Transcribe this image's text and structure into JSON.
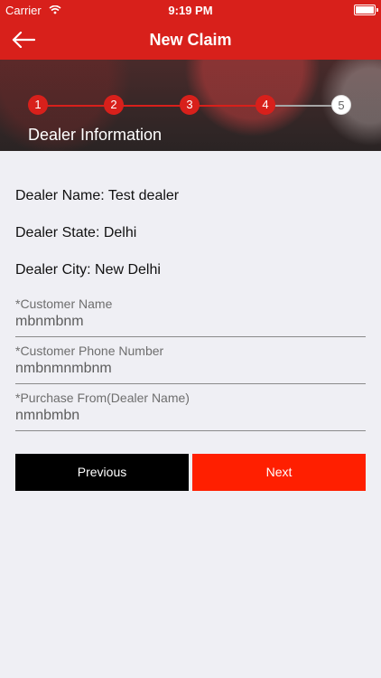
{
  "status_bar": {
    "carrier": "Carrier",
    "time": "9:19 PM"
  },
  "nav": {
    "title": "New Claim",
    "back_icon": "back-arrow-icon"
  },
  "steps": {
    "items": [
      "1",
      "2",
      "3",
      "4",
      "5"
    ],
    "active_count": 4,
    "section_title": "Dealer Information",
    "active_color": "#d8201b"
  },
  "info": {
    "dealer_name": "Dealer Name: Test dealer",
    "dealer_state": "Dealer State: Delhi",
    "dealer_city": "Dealer City: New Delhi"
  },
  "fields": [
    {
      "label": "*Customer Name",
      "value": "mbnmbnm"
    },
    {
      "label": "*Customer Phone Number",
      "value": "nmbnmnmbnm"
    },
    {
      "label": "*Purchase From(Dealer Name)",
      "value": "nmnbmbn"
    }
  ],
  "buttons": {
    "previous": "Previous",
    "next": "Next"
  },
  "colors": {
    "brand": "#d8201b",
    "next_button": "#ff1f00",
    "previous_button": "#000000",
    "background": "#efeff4"
  }
}
